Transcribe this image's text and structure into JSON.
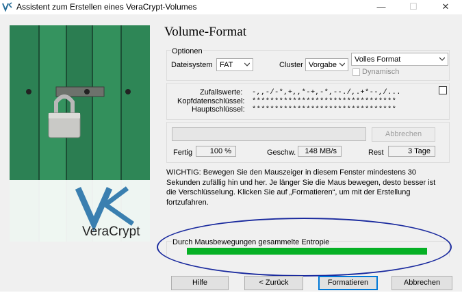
{
  "window": {
    "title": "Assistent zum Erstellen eines VeraCrypt-Volumes",
    "controls": {
      "minimize": "—",
      "maximize": "☐",
      "close": "✕"
    }
  },
  "branding": {
    "logo_text": "VeraCrypt"
  },
  "page": {
    "heading": "Volume-Format"
  },
  "options": {
    "group_label": "Optionen",
    "filesystem_label": "Dateisystem",
    "filesystem_value": "FAT",
    "cluster_label": "Cluster",
    "cluster_value": "Vorgabe",
    "format_mode_value": "Volles Format",
    "dynamic_label": "Dynamisch"
  },
  "keys": {
    "random_label": "Zufallswerte:",
    "random_value": "-,,-/-*,+,,*-+,-*,--./,.+*--,/...",
    "header_key_label": "Kopfdatenschlüssel:",
    "header_key_value": "********************************",
    "master_key_label": "Hauptschlüssel:",
    "master_key_value": "********************************"
  },
  "progress": {
    "fraction": 0,
    "abort_label": "Abbrechen",
    "done_label": "Fertig",
    "done_value": "100 %",
    "speed_label": "Geschw.",
    "speed_value": "148 MB/s",
    "remaining_label": "Rest",
    "remaining_value": "3 Tage"
  },
  "info_text": "WICHTIG: Bewegen Sie den Mauszeiger in diesem Fenster mindestens 30 Sekunden zufällig hin und her. Je länger Sie die Maus bewegen, desto besser ist die Verschlüsselung. Klicken Sie auf „Formatieren“, um mit der Erstellung fortzufahren.",
  "entropy": {
    "label": "Durch Mausbewegungen gesammelte Entropie",
    "fraction": 1.0
  },
  "buttons": {
    "help": "Hilfe",
    "back": "< Zurück",
    "format": "Formatieren",
    "cancel": "Abbrechen"
  },
  "colors": {
    "entropy_fill": "#06b025",
    "annotation_oval": "#1a2a9e"
  }
}
